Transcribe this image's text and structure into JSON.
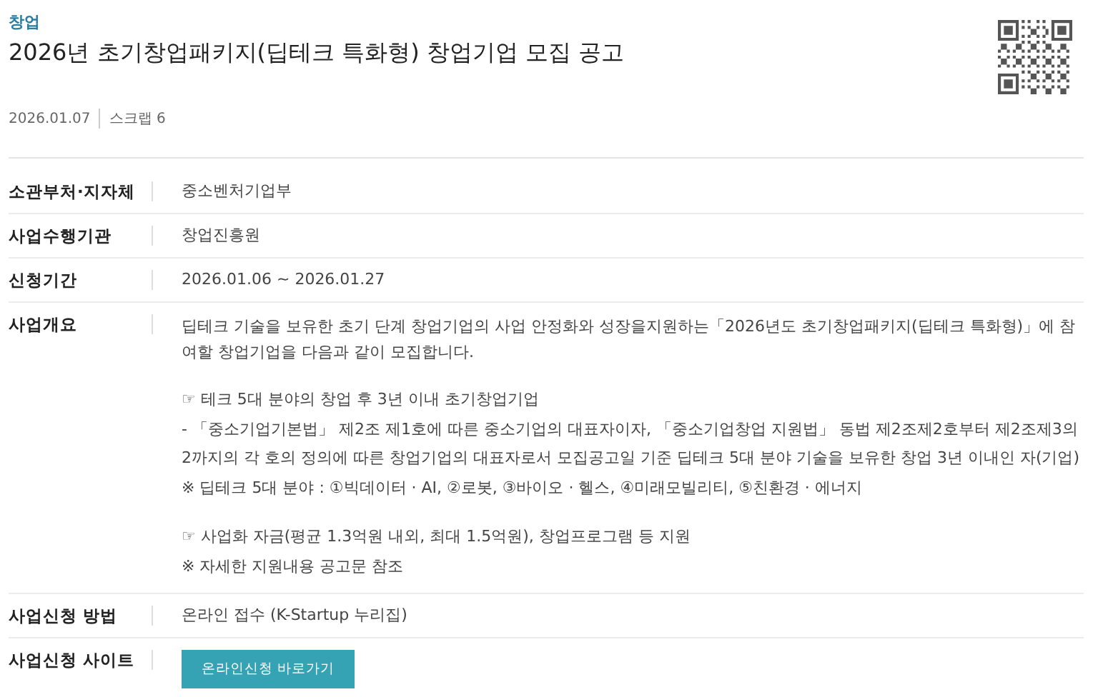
{
  "category": "창업",
  "title": "2026년 초기창업패키지(딥테크 특화형) 창업기업 모집 공고",
  "meta": {
    "date": "2026.01.07",
    "scrap": "스크랩 6"
  },
  "fields": [
    {
      "kind": "text",
      "label": "소관부처·지자체",
      "value": "중소벤처기업부"
    },
    {
      "kind": "text",
      "label": "사업수행기관",
      "value": "창업진흥원"
    },
    {
      "kind": "text",
      "label": "신청기간",
      "value": "2026.01.06 ~ 2026.01.27"
    },
    {
      "kind": "blocks",
      "label": "사업개요",
      "blocks": [
        [
          "딥테크 기술을 보유한 초기 단계 창업기업의 사업 안정화와 성장을지원하는「2026년도 초기창업패키지(딥테크 특화형)」에 참여할 창업기업을 다음과 같이 모집합니다."
        ],
        [
          "☞ 테크 5대 분야의 창업 후 3년 이내 초기창업기업",
          "- 「중소기업기본법」 제2조 제1호에 따른 중소기업의 대표자이자, 「중소기업창업 지원법」 동법 제2조제2호부터 제2조제3의2까지의 각 호의 정의에 따른 창업기업의 대표자로서 모집공고일 기준 딥테크 5대 분야 기술을 보유한 창업 3년 이내인 자(기업)",
          "※ 딥테크 5대 분야 : ①빅데이터 · AI, ②로봇, ③바이오 · 헬스, ④미래모빌리티, ⑤친환경 · 에너지"
        ],
        [
          "☞ 사업화 자금(평균 1.3억원 내외, 최대 1.5억원), 창업프로그램 등 지원",
          "※ 자세한 지원내용 공고문 참조"
        ]
      ]
    },
    {
      "kind": "text",
      "label": "사업신청 방법",
      "value": "온라인 접수 (K-Startup 누리집)"
    },
    {
      "kind": "button",
      "label": "사업신청 사이트",
      "button": "온라인신청 바로가기"
    }
  ]
}
